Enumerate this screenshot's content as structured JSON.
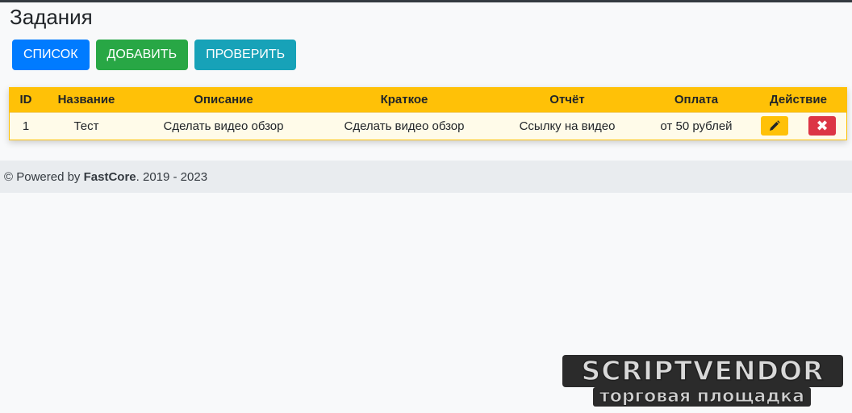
{
  "page": {
    "title": "Задания"
  },
  "toolbar": {
    "list_label": "СПИСОК",
    "add_label": "ДОБАВИТЬ",
    "check_label": "ПРОВЕРИТЬ"
  },
  "table": {
    "headers": [
      "ID",
      "Название",
      "Описание",
      "Краткое",
      "Отчёт",
      "Оплата",
      "Действие"
    ],
    "rows": [
      {
        "id": "1",
        "name": "Тест",
        "description": "Сделать видео обзор",
        "short": "Сделать видео обзор",
        "report": "Ссылку на видео",
        "payment": "от 50 рублей",
        "edit_icon": "pencil-icon",
        "delete_icon": "close-icon"
      }
    ]
  },
  "footer": {
    "prefix": "© Powered by ",
    "brand": "FastCore",
    "suffix": ". 2019 - 2023"
  },
  "watermark": {
    "main": "SCRIPTVENDOR",
    "sub": "торговая площадка"
  },
  "colors": {
    "primary": "#007bff",
    "success": "#28a745",
    "info": "#17a2b8",
    "warning": "#ffc107",
    "danger": "#dc3545"
  }
}
